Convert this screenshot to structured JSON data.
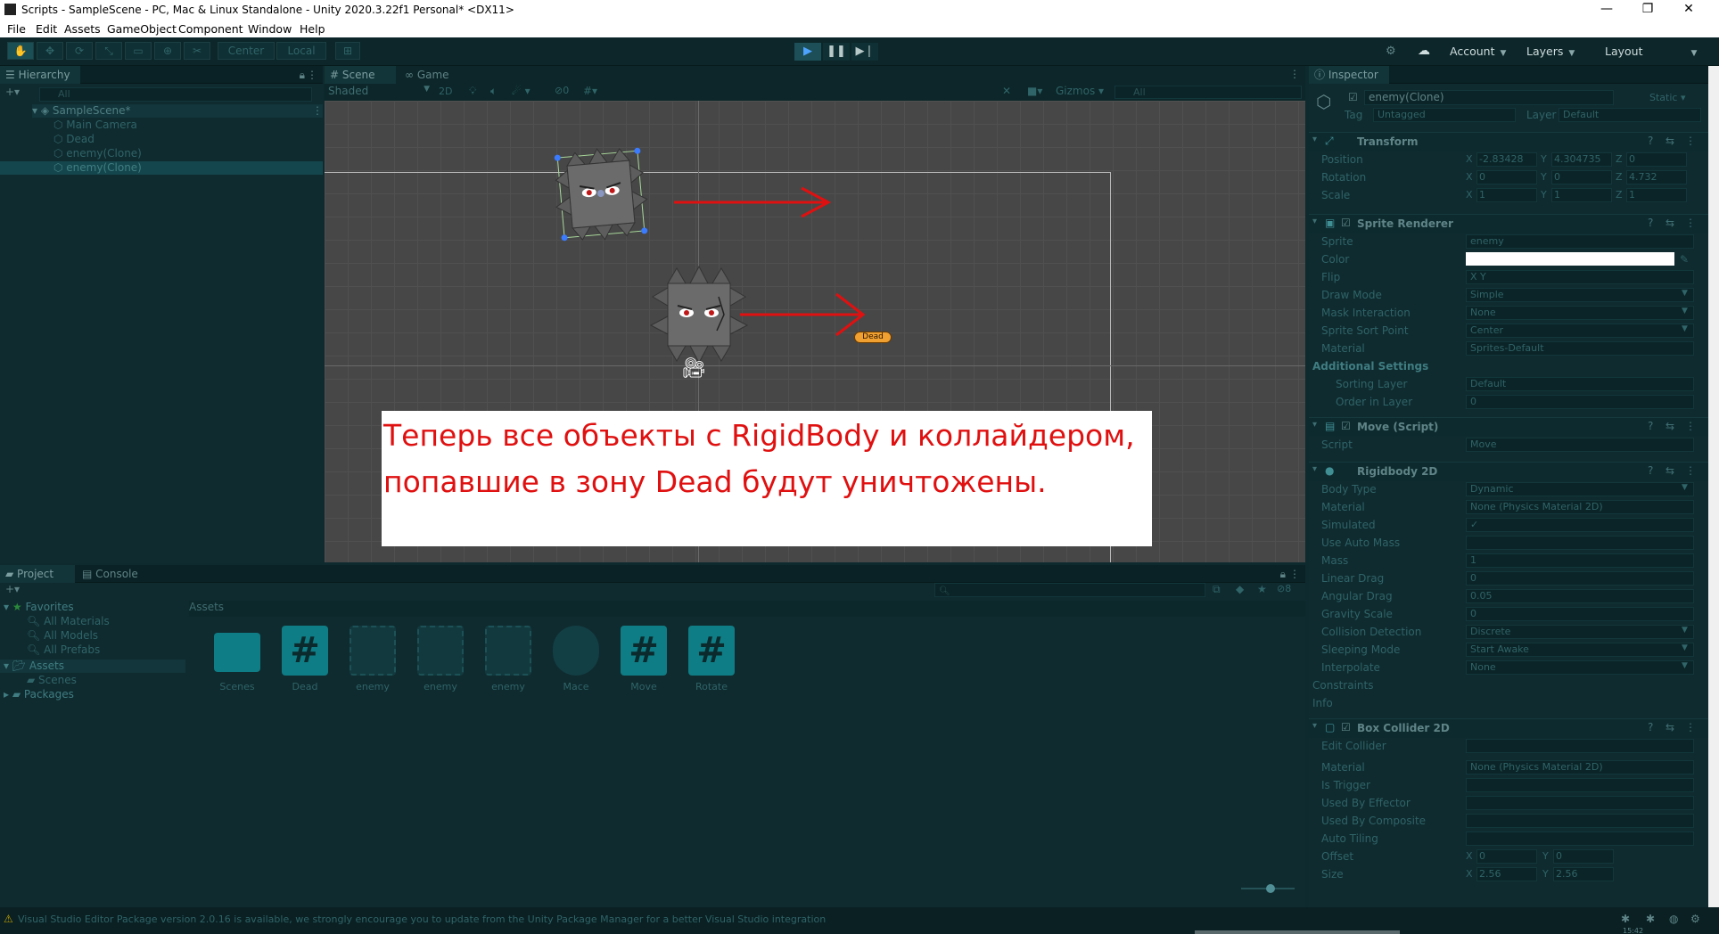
{
  "window": {
    "title": "Scripts - SampleScene - PC, Mac & Linux Standalone - Unity 2020.3.22f1 Personal* <DX11>",
    "controls": {
      "minimize": "—",
      "maximize": "❐",
      "close": "✕"
    }
  },
  "menu": [
    "File",
    "Edit",
    "Assets",
    "GameObject",
    "Component",
    "Window",
    "Help"
  ],
  "toolbar": {
    "pivot": "Center",
    "space": "Local",
    "account": "Account",
    "layers": "Layers",
    "layout": "Layout"
  },
  "hierarchy": {
    "tab": "Hierarchy",
    "search_placeholder": "All",
    "scene": "SampleScene*",
    "items": [
      "Main Camera",
      "Dead",
      "enemy(Clone)",
      "enemy(Clone)"
    ]
  },
  "scene_view": {
    "tabs": [
      "Scene",
      "Game"
    ],
    "shading": "Shaded",
    "mode_2d": "2D",
    "hidden_count": "0",
    "gizmos": "Gizmos",
    "search_placeholder": "All",
    "dead_label": "Dead",
    "overlay_text": "Теперь все объекты с RigidBody и коллайдером, попавшие в зону Dead будут уничтожены."
  },
  "inspector": {
    "tab": "Inspector",
    "object_name": "enemy(Clone)",
    "static_label": "Static",
    "tag_label": "Tag",
    "tag_value": "Untagged",
    "layer_label": "Layer",
    "layer_value": "Default",
    "transform": {
      "title": "Transform",
      "rows": [
        {
          "label": "Position",
          "x": "-2.83428",
          "y": "4.304735",
          "z": "0"
        },
        {
          "label": "Rotation",
          "x": "0",
          "y": "0",
          "z": "4.732"
        },
        {
          "label": "Scale",
          "x": "1",
          "y": "1",
          "z": "1"
        }
      ]
    },
    "sprite_renderer": {
      "title": "Sprite Renderer",
      "rows": [
        {
          "label": "Sprite",
          "value": "enemy"
        },
        {
          "label": "Color",
          "value": ""
        },
        {
          "label": "Flip",
          "value": "X       Y"
        },
        {
          "label": "Draw Mode",
          "value": "Simple"
        },
        {
          "label": "Mask Interaction",
          "value": "None"
        },
        {
          "label": "Sprite Sort Point",
          "value": "Center"
        },
        {
          "label": "Material",
          "value": "Sprites-Default"
        }
      ],
      "additional_settings": "Additional Settings",
      "sub_rows": [
        {
          "label": "Sorting Layer",
          "value": "Default"
        },
        {
          "label": "Order in Layer",
          "value": "0"
        }
      ]
    },
    "move_script": {
      "title": "Move (Script)",
      "script_label": "Script",
      "script_value": "Move"
    },
    "rigidbody": {
      "title": "Rigidbody 2D",
      "rows": [
        {
          "label": "Body Type",
          "value": "Dynamic"
        },
        {
          "label": "Material",
          "value": "None (Physics Material 2D)"
        },
        {
          "label": "Simulated",
          "value": "✓"
        },
        {
          "label": "Use Auto Mass",
          "value": ""
        },
        {
          "label": "Mass",
          "value": "1"
        },
        {
          "label": "Linear Drag",
          "value": "0"
        },
        {
          "label": "Angular Drag",
          "value": "0.05"
        },
        {
          "label": "Gravity Scale",
          "value": "0"
        },
        {
          "label": "Collision Detection",
          "value": "Discrete"
        },
        {
          "label": "Sleeping Mode",
          "value": "Start Awake"
        },
        {
          "label": "Interpolate",
          "value": "None"
        }
      ],
      "constraints": "Constraints",
      "info": "Info"
    },
    "box_collider": {
      "title": "Box Collider 2D",
      "rows": [
        {
          "label": "Edit Collider",
          "value": ""
        },
        {
          "label": "Material",
          "value": "None (Physics Material 2D)"
        },
        {
          "label": "Is Trigger",
          "value": ""
        },
        {
          "label": "Used By Effector",
          "value": ""
        },
        {
          "label": "Used By Composite",
          "value": ""
        },
        {
          "label": "Auto Tiling",
          "value": ""
        }
      ],
      "offset_label": "Offset",
      "offset_x": "0",
      "offset_y": "0",
      "size_label": "Size",
      "size_x": "2.56",
      "size_y": "2.56"
    }
  },
  "project": {
    "tabs": [
      "Project",
      "Console"
    ],
    "favorites": "Favorites",
    "favorite_items": [
      "All Materials",
      "All Models",
      "All Prefabs"
    ],
    "assets_root": "Assets",
    "assets_children": [
      "Scenes"
    ],
    "packages": "Packages",
    "breadcrumb": "Assets",
    "hidden_count": "8",
    "assets": [
      {
        "name": "Scenes",
        "icon": "folder-icon"
      },
      {
        "name": "Dead",
        "icon": "csharp-script-icon"
      },
      {
        "name": "enemy",
        "icon": "enemy-sprite-icon"
      },
      {
        "name": "enemy",
        "icon": "enemy-sprite-icon"
      },
      {
        "name": "enemy",
        "icon": "enemy-sprite-icon"
      },
      {
        "name": "Mace",
        "icon": "mace-sprite-icon"
      },
      {
        "name": "Move",
        "icon": "csharp-script-icon"
      },
      {
        "name": "Rotate",
        "icon": "csharp-script-icon"
      }
    ]
  },
  "status_bar": {
    "message": "Visual Studio Editor Package version 2.0.16 is available, we strongly encourage you to update from the Unity Package Manager for a better Visual Studio integration",
    "clock": "15:42"
  },
  "colors": {
    "overlay_text": "#e01010",
    "arrow": "#e01010",
    "accent": "#1f6fb5",
    "asset_teal": "#0f7d85",
    "dead_badge": "#f0a030"
  }
}
